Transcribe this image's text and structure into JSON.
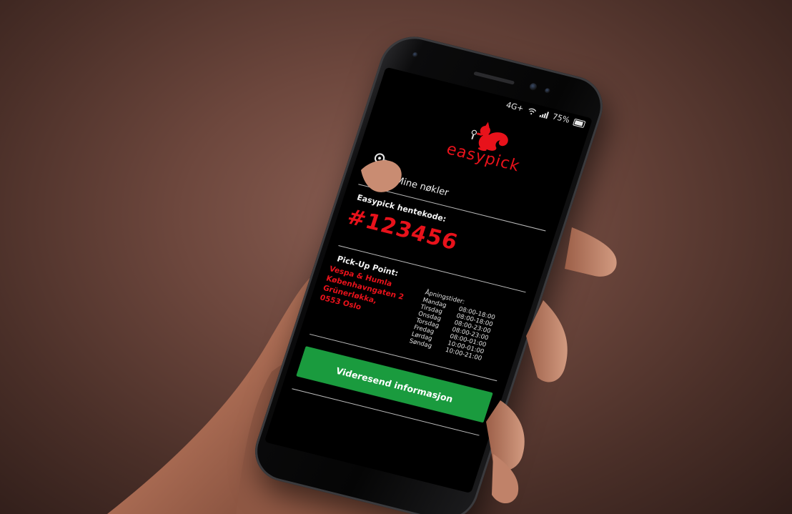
{
  "status": {
    "network": "4G+",
    "battery": "75%"
  },
  "brand": {
    "logo_text": "easypick",
    "accent_color": "#e8121b",
    "button_color": "#1a9b3e"
  },
  "keys": {
    "label": "Mine nøkler",
    "icon": "keys-icon"
  },
  "pickup_code": {
    "label": "Easypick hentekode:",
    "value": "#123456"
  },
  "pickup_point": {
    "label": "Pick-Up Point:",
    "address": [
      "Vespa & Humla",
      "Københavngaten 2",
      "Grünerløkka,",
      "0553 Oslo"
    ]
  },
  "opening_hours": {
    "title": "Åpningstider:",
    "rows": [
      {
        "day": "Mandag",
        "time": "08:00-18:00"
      },
      {
        "day": "Tirsdag",
        "time": "08:00-18:00"
      },
      {
        "day": "Onsdag",
        "time": "08:00-23:00"
      },
      {
        "day": "Torsdag",
        "time": "08:00-23:00"
      },
      {
        "day": "Fredag",
        "time": "08:00-01:00"
      },
      {
        "day": "Lørdag",
        "time": "10:00-01:00"
      },
      {
        "day": "Søndag",
        "time": "10:00-21:00"
      }
    ]
  },
  "actions": {
    "forward_label": "Videresend informasjon"
  }
}
